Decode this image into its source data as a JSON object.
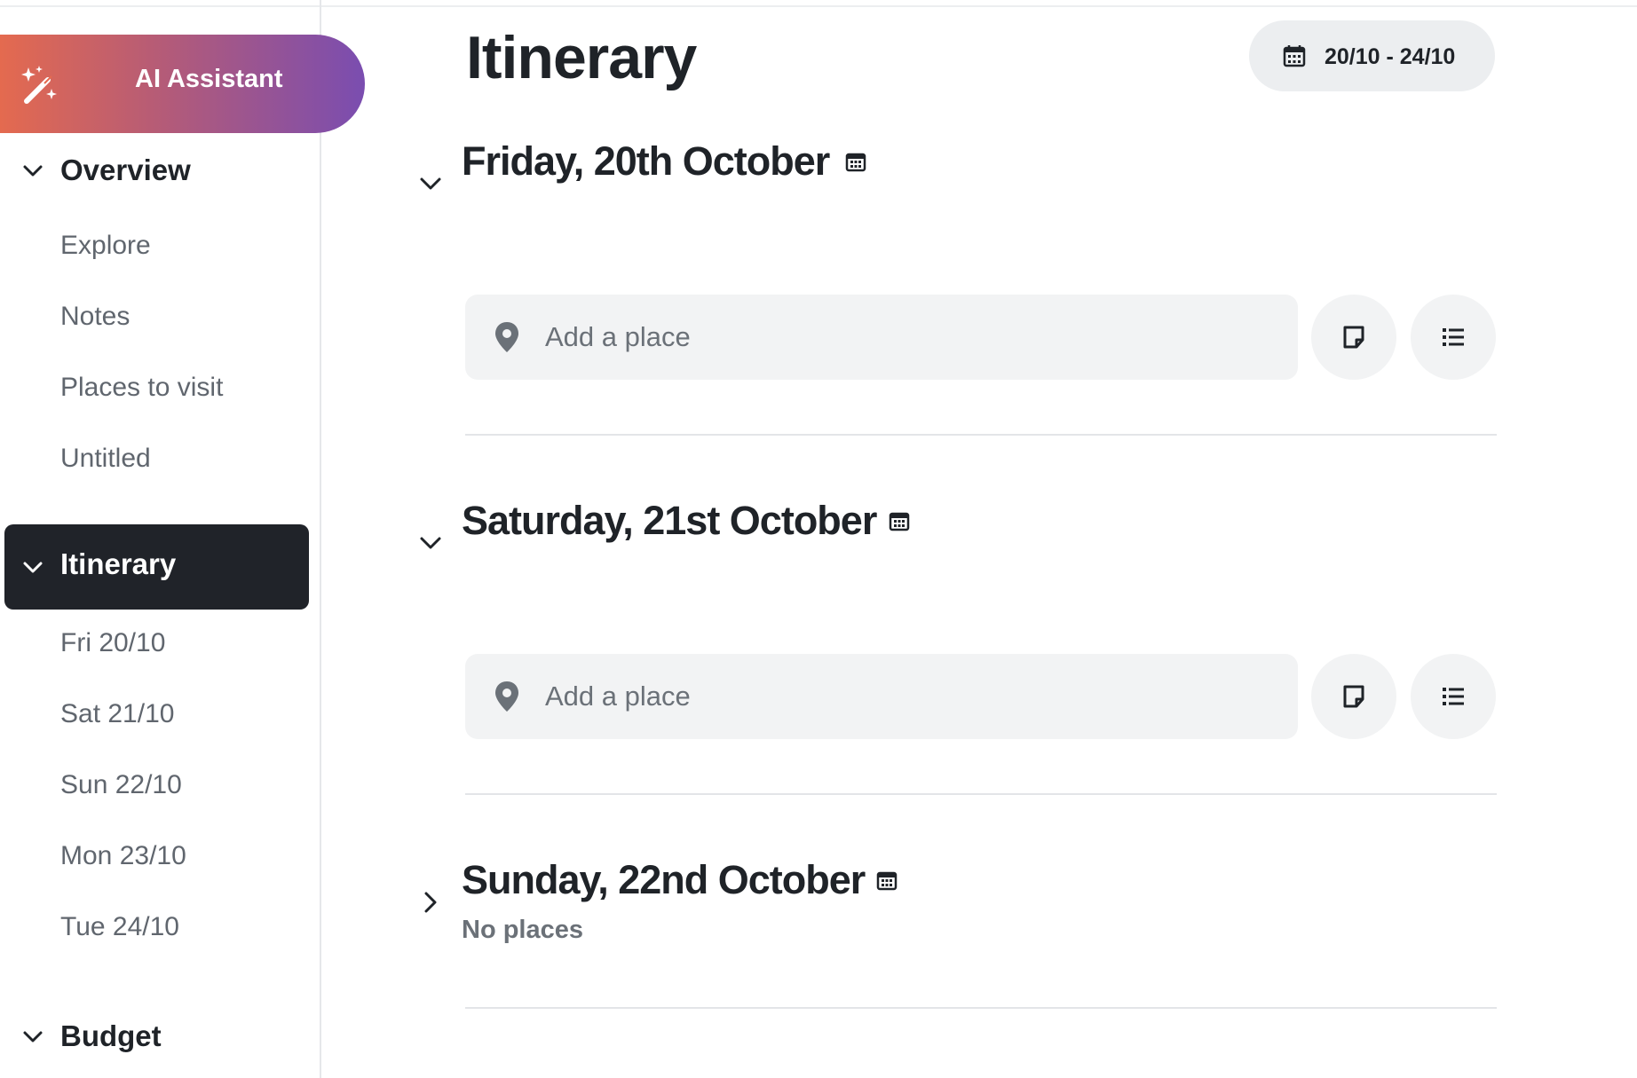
{
  "ai_assistant": {
    "label": "AI Assistant"
  },
  "sidebar": {
    "overview": {
      "label": "Overview",
      "items": [
        {
          "label": "Explore"
        },
        {
          "label": "Notes"
        },
        {
          "label": "Places to visit"
        },
        {
          "label": "Untitled"
        }
      ]
    },
    "itinerary": {
      "label": "Itinerary",
      "items": [
        {
          "label": "Fri 20/10"
        },
        {
          "label": "Sat 21/10"
        },
        {
          "label": "Sun 22/10"
        },
        {
          "label": "Mon 23/10"
        },
        {
          "label": "Tue 24/10"
        }
      ]
    },
    "budget": {
      "label": "Budget"
    }
  },
  "main": {
    "title": "Itinerary",
    "date_range": "20/10 - 24/10",
    "days": [
      {
        "title": "Friday, 20th October",
        "expanded": true,
        "add_place_placeholder": "Add a place"
      },
      {
        "title": "Saturday, 21st October",
        "expanded": true,
        "add_place_placeholder": "Add a place"
      },
      {
        "title": "Sunday, 22nd October",
        "expanded": false,
        "status": "No places"
      }
    ]
  },
  "colors": {
    "ai_gradient_start": "#e46a4f",
    "ai_gradient_end": "#7a4db0",
    "active_nav_bg": "#202329",
    "input_bg": "#f2f3f4"
  },
  "icons": {
    "ai": "magic-wand-icon",
    "expand": "chevron-down-icon",
    "collapsed": "chevron-right-icon",
    "calendar": "calendar-icon",
    "place": "map-pin-icon",
    "note": "sticky-note-icon",
    "list": "checklist-icon"
  }
}
